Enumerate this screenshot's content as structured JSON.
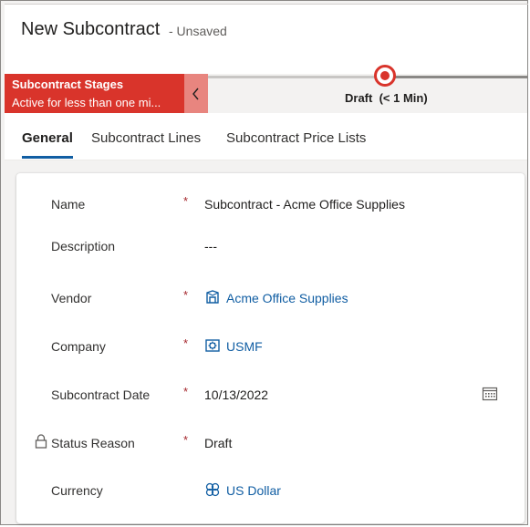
{
  "header": {
    "title": "New Subcontract",
    "status": "- Unsaved"
  },
  "bpf": {
    "flyout_title": "Subcontract Stages",
    "flyout_subtitle": "Active for less than one mi...",
    "active_stage": "Draft",
    "active_stage_duration": "(< 1 Min)"
  },
  "tabs": [
    {
      "label": "General",
      "active": true
    },
    {
      "label": "Subcontract Lines",
      "active": false
    },
    {
      "label": "Subcontract Price Lists",
      "active": false
    }
  ],
  "form": {
    "name": {
      "label": "Name",
      "required": "*",
      "value": "Subcontract - Acme Office Supplies"
    },
    "description": {
      "label": "Description",
      "value": "---"
    },
    "vendor": {
      "label": "Vendor",
      "required": "*",
      "value": "Acme Office Supplies",
      "icon": "vendor-icon"
    },
    "company": {
      "label": "Company",
      "required": "*",
      "value": "USMF",
      "icon": "company-icon"
    },
    "date": {
      "label": "Subcontract Date",
      "required": "*",
      "value": "10/13/2022",
      "icon": "calendar-icon"
    },
    "status_reason": {
      "label": "Status Reason",
      "required": "*",
      "value": "Draft",
      "icon": "lock-icon"
    },
    "currency": {
      "label": "Currency",
      "value": "US Dollar",
      "icon": "currency-icon"
    }
  },
  "colors": {
    "accent": "#d9342b",
    "link": "#115ea3",
    "required": "#a4262c"
  }
}
